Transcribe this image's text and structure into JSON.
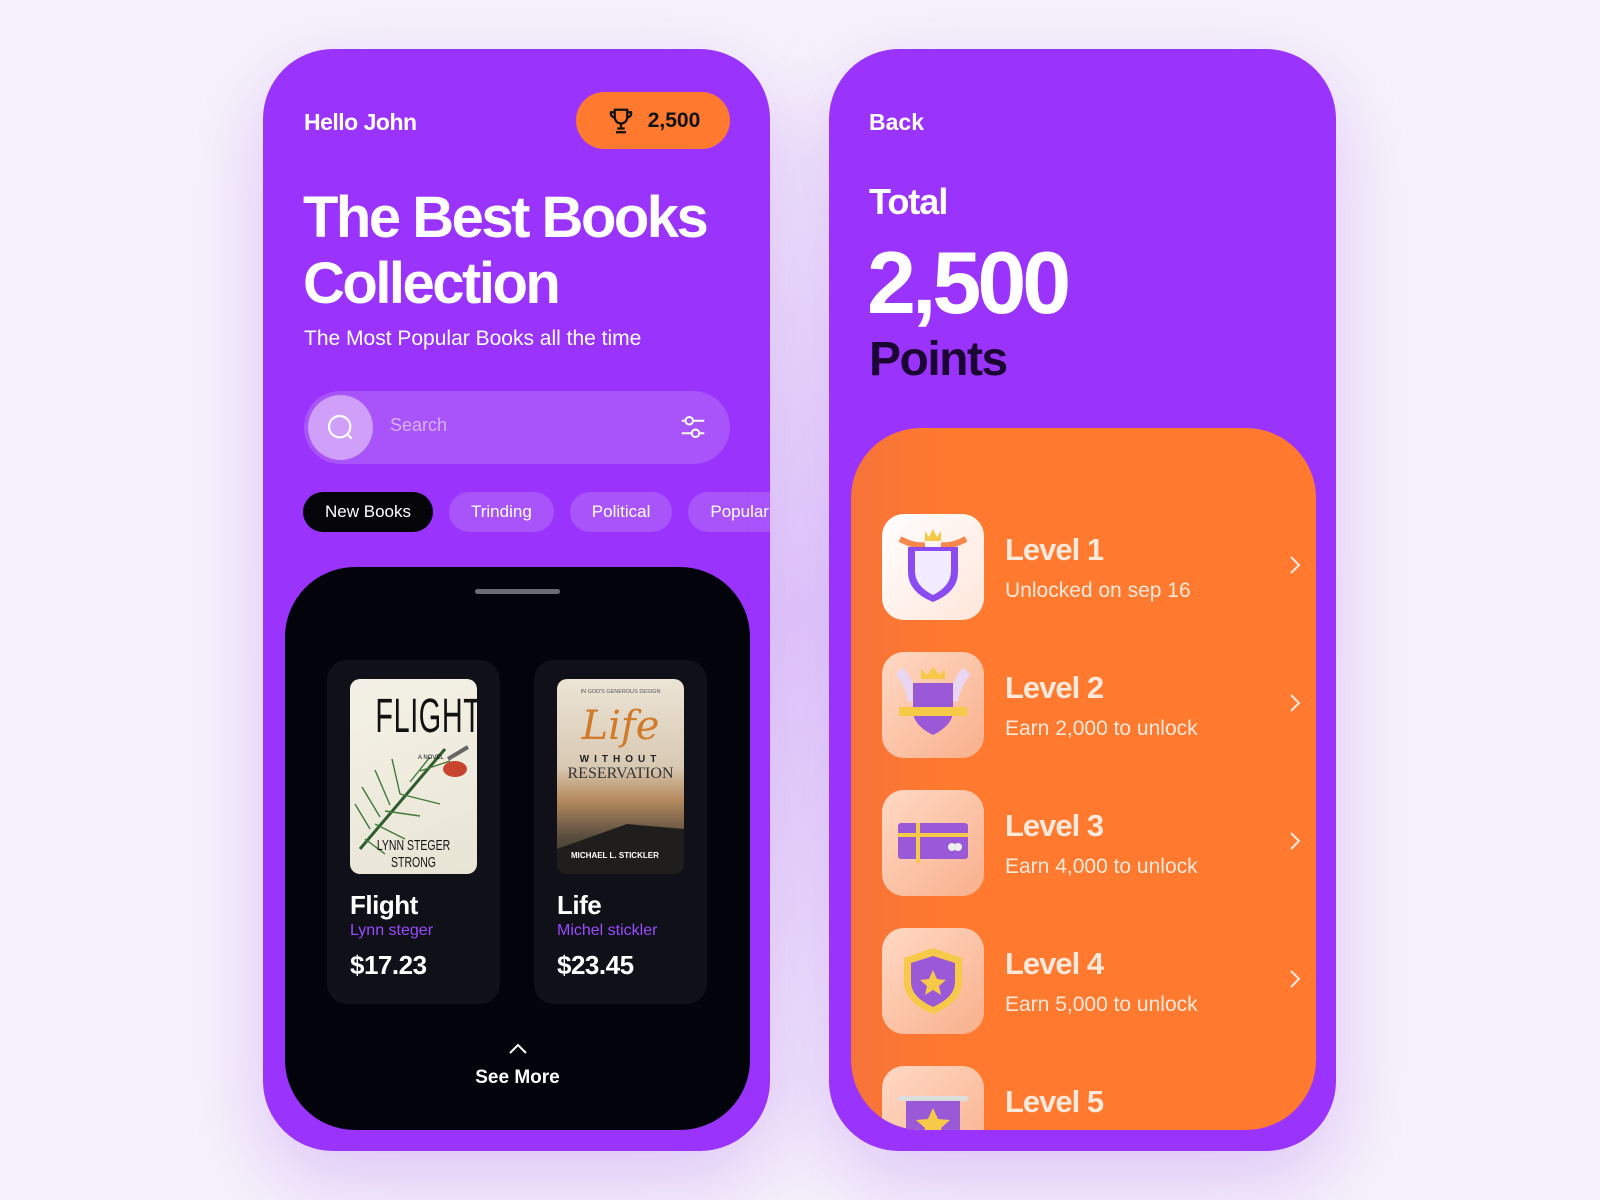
{
  "colors": {
    "purple": "#9a33fb",
    "orange": "#ff7a2e",
    "dark": "#03040b",
    "author": "#9a4bff"
  },
  "home": {
    "greeting": "Hello John",
    "points_badge": {
      "icon": "trophy-icon",
      "value": "2,500"
    },
    "title_line1": "The Best Books",
    "title_line2": "Collection",
    "subtitle": "The Most Popular Books all the time",
    "search": {
      "placeholder": "Search",
      "icon": "search-icon",
      "filter_icon": "sliders-icon"
    },
    "chips": [
      {
        "label": "New Books",
        "active": true
      },
      {
        "label": "Trinding"
      },
      {
        "label": "Political"
      },
      {
        "label": "Popular"
      }
    ],
    "books": [
      {
        "title": "Flight",
        "author": "Lynn steger",
        "price": "$17.23",
        "cover": {
          "title": "FLIGHT",
          "subtitle": "A NOVEL",
          "author": "LYNN STEGER STRONG"
        }
      },
      {
        "title": "Life",
        "author": "Michel stickler",
        "price": "$23.45",
        "cover": {
          "top": "IN GOD'S GENEROUS DESIGN",
          "script": "Life",
          "line2": "WITHOUT",
          "line3": "RESERVATION",
          "author": "MICHAEL L. STICKLER"
        }
      }
    ],
    "see_more": "See More"
  },
  "points": {
    "back": "Back",
    "total_label": "Total",
    "total": "2,500",
    "unit": "Points",
    "levels": [
      {
        "title": "Level 1",
        "status": "Unlocked on sep 16",
        "icon": "shield-badge-icon"
      },
      {
        "title": "Level 2",
        "status": "Earn 2,000 to unlock",
        "icon": "crown-shield-icon"
      },
      {
        "title": "Level 3",
        "status": "Earn 4,000 to unlock",
        "icon": "gift-card-icon"
      },
      {
        "title": "Level 4",
        "status": "Earn 5,000 to unlock",
        "icon": "star-shield-icon"
      },
      {
        "title": "Level 5",
        "status": "",
        "icon": "star-banner-icon"
      }
    ]
  }
}
